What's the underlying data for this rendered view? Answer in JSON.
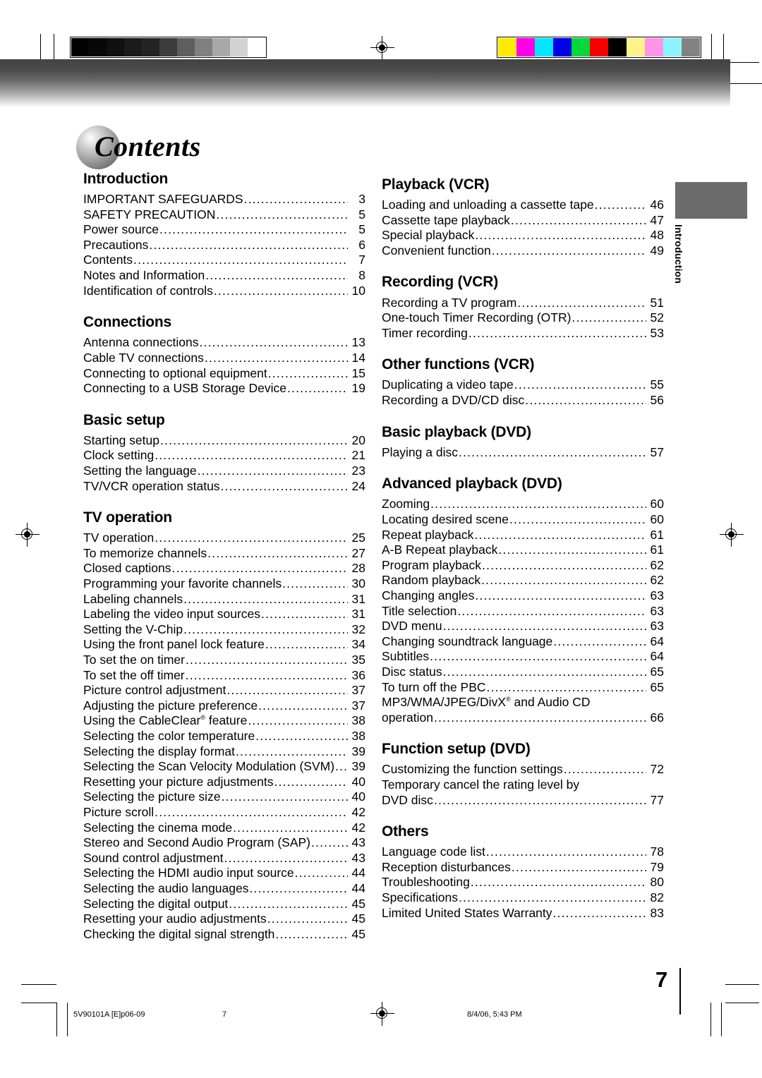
{
  "document": {
    "title": "Contents",
    "folio": "7",
    "side_tab_label": "Introduction"
  },
  "footer": {
    "file_slug": "5V90101A [E]p06-09",
    "page_number": "7",
    "timestamp": "8/4/06, 5:43 PM"
  },
  "prepress": {
    "gray_wedge_steps": [
      "#030303",
      "#080808",
      "#101010",
      "#1b1b1b",
      "#242424",
      "#3c3c3c",
      "#5e5e5e",
      "#808080",
      "#a8a8a8",
      "#d2d2d2",
      "#ffffff"
    ],
    "color_patches": [
      "#ffeb00",
      "#ff00e6",
      "#00e8ff",
      "#0000e6",
      "#00d83c",
      "#f40000",
      "#000000",
      "#fff38a",
      "#ff94ea",
      "#8cf4ff",
      "#828282"
    ],
    "banner_color": "#434343",
    "side_tab_color": "#6b6b6b"
  },
  "columns": {
    "left": [
      {
        "heading": "Introduction",
        "entries": [
          {
            "label": "IMPORTANT SAFEGUARDS",
            "page": "3"
          },
          {
            "label": "SAFETY PRECAUTION",
            "page": "5"
          },
          {
            "label": "Power source",
            "page": "5"
          },
          {
            "label": "Precautions",
            "page": "6"
          },
          {
            "label": "Contents",
            "page": "7"
          },
          {
            "label": "Notes and Information",
            "page": "8"
          },
          {
            "label": "Identification of controls",
            "page": "10"
          }
        ]
      },
      {
        "heading": "Connections",
        "entries": [
          {
            "label": "Antenna connections",
            "page": "13"
          },
          {
            "label": "Cable TV connections",
            "page": "14"
          },
          {
            "label": "Connecting to optional equipment",
            "page": "15"
          },
          {
            "label": "Connecting to a USB Storage Device",
            "page": "19"
          }
        ]
      },
      {
        "heading": "Basic setup",
        "entries": [
          {
            "label": "Starting setup",
            "page": "20"
          },
          {
            "label": "Clock setting",
            "page": "21"
          },
          {
            "label": "Setting the language",
            "page": "23"
          },
          {
            "label": "TV/VCR operation status",
            "page": "24"
          }
        ]
      },
      {
        "heading": "TV operation",
        "entries": [
          {
            "label": "TV operation",
            "page": "25"
          },
          {
            "label": "To memorize channels",
            "page": "27"
          },
          {
            "label": "Closed captions",
            "page": "28"
          },
          {
            "label": "Programming your favorite channels",
            "page": "30"
          },
          {
            "label": "Labeling channels",
            "page": "31"
          },
          {
            "label": "Labeling the video input sources",
            "page": "31"
          },
          {
            "label": "Setting the V-Chip",
            "page": "32"
          },
          {
            "label": "Using the front panel lock feature",
            "page": "34"
          },
          {
            "label": "To set the on timer",
            "page": "35"
          },
          {
            "label": "To set the off timer",
            "page": "36"
          },
          {
            "label": "Picture control adjustment",
            "page": "37"
          },
          {
            "label": "Adjusting the picture preference",
            "page": "37"
          },
          {
            "label": "Using the CableClear® feature",
            "page": "38"
          },
          {
            "label": "Selecting the color temperature",
            "page": "38"
          },
          {
            "label": "Selecting the display format",
            "page": "39"
          },
          {
            "label": "Selecting the Scan Velocity Modulation (SVM)",
            "page": "39"
          },
          {
            "label": "Resetting your picture adjustments",
            "page": "40"
          },
          {
            "label": "Selecting the picture size",
            "page": "40"
          },
          {
            "label": "Picture scroll",
            "page": "42"
          },
          {
            "label": "Selecting the cinema mode",
            "page": "42"
          },
          {
            "label": "Stereo and Second Audio Program (SAP)",
            "page": "43"
          },
          {
            "label": "Sound control adjustment",
            "page": "43"
          },
          {
            "label": "Selecting the HDMI audio input source",
            "page": "44"
          },
          {
            "label": "Selecting the audio languages",
            "page": "44"
          },
          {
            "label": "Selecting the digital output",
            "page": "45"
          },
          {
            "label": "Resetting your audio adjustments",
            "page": "45"
          },
          {
            "label": "Checking the digital signal strength",
            "page": "45"
          }
        ]
      }
    ],
    "right": [
      {
        "heading": "Playback (VCR)",
        "entries": [
          {
            "label": "Loading and unloading a cassette tape",
            "page": "46"
          },
          {
            "label": "Cassette tape playback",
            "page": "47"
          },
          {
            "label": "Special playback",
            "page": "48"
          },
          {
            "label": "Convenient function",
            "page": "49"
          }
        ]
      },
      {
        "heading": "Recording (VCR)",
        "entries": [
          {
            "label": "Recording a TV program",
            "page": "51"
          },
          {
            "label": "One-touch Timer Recording (OTR)",
            "page": "52"
          },
          {
            "label": "Timer recording",
            "page": "53"
          }
        ]
      },
      {
        "heading": "Other functions (VCR)",
        "entries": [
          {
            "label": "Duplicating a video tape",
            "page": "55"
          },
          {
            "label": "Recording a DVD/CD disc",
            "page": "56"
          }
        ]
      },
      {
        "heading": "Basic playback (DVD)",
        "entries": [
          {
            "label": "Playing a disc",
            "page": "57"
          }
        ]
      },
      {
        "heading": "Advanced playback (DVD)",
        "entries": [
          {
            "label": "Zooming",
            "page": "60"
          },
          {
            "label": "Locating desired scene",
            "page": "60"
          },
          {
            "label": "Repeat playback",
            "page": "61"
          },
          {
            "label": "A-B Repeat playback",
            "page": "61"
          },
          {
            "label": "Program playback",
            "page": "62"
          },
          {
            "label": "Random playback",
            "page": "62"
          },
          {
            "label": "Changing angles",
            "page": "63"
          },
          {
            "label": "Title selection",
            "page": "63"
          },
          {
            "label": "DVD menu",
            "page": "63"
          },
          {
            "label": "Changing soundtrack language",
            "page": "64"
          },
          {
            "label": "Subtitles",
            "page": "64"
          },
          {
            "label": "Disc status",
            "page": "65"
          },
          {
            "label": "To turn off the PBC",
            "page": "65"
          },
          {
            "label": "MP3/WMA/JPEG/DivX® and Audio CD",
            "page": "",
            "wrapped": true
          },
          {
            "label": "operation",
            "page": "66"
          }
        ]
      },
      {
        "heading": "Function setup (DVD)",
        "entries": [
          {
            "label": "Customizing the function settings",
            "page": "72"
          },
          {
            "label": "Temporary cancel the rating level by",
            "page": "",
            "wrapped": true
          },
          {
            "label": "DVD disc",
            "page": "77"
          }
        ]
      },
      {
        "heading": "Others",
        "entries": [
          {
            "label": "Language code list",
            "page": "78"
          },
          {
            "label": "Reception disturbances",
            "page": "79"
          },
          {
            "label": "Troubleshooting",
            "page": "80"
          },
          {
            "label": "Specifications",
            "page": "82"
          },
          {
            "label": "Limited United States Warranty",
            "page": "83"
          }
        ]
      }
    ]
  }
}
